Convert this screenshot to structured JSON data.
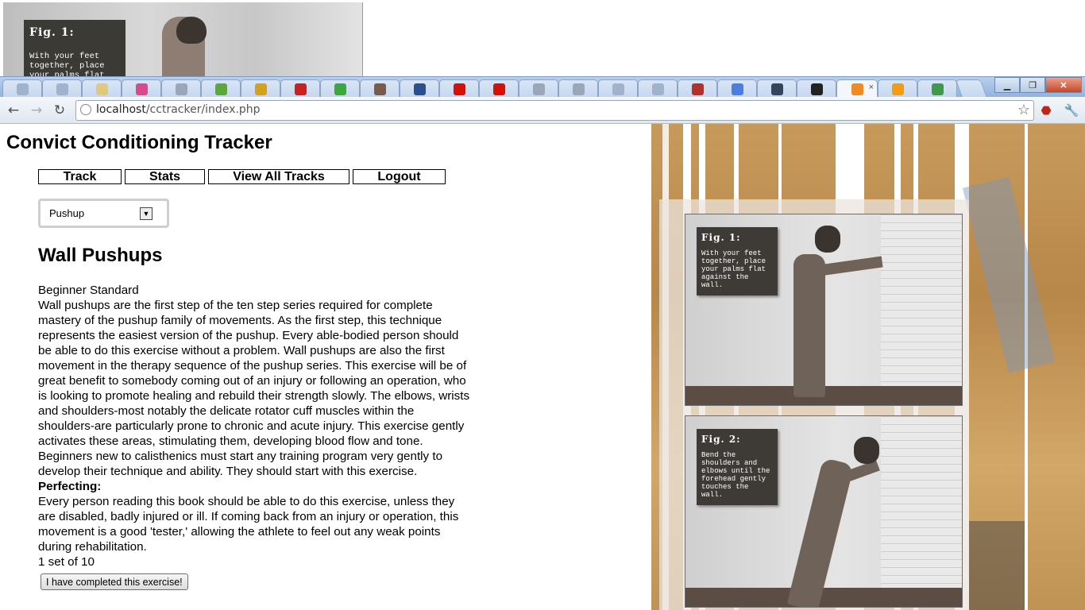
{
  "float_fig": {
    "caption_title": "Fig. 1:",
    "caption_text": "With your feet together, place your palms flat"
  },
  "browser": {
    "tabs": [
      {
        "icon": "reddit-icon",
        "color": "#9fb4cc"
      },
      {
        "icon": "reddit-icon",
        "color": "#9fb4cc"
      },
      {
        "icon": "heart-icon",
        "color": "#e0c97a"
      },
      {
        "icon": "d20-icon",
        "color": "#d94a8c"
      },
      {
        "icon": "globe-icon",
        "color": "#9aa7b8"
      },
      {
        "icon": "sprout-icon",
        "color": "#5aa83a"
      },
      {
        "icon": "fish-icon",
        "color": "#d4a21a"
      },
      {
        "icon": "youtube-icon",
        "color": "#cc2020"
      },
      {
        "icon": "meetup-icon",
        "color": "#3aa83a"
      },
      {
        "icon": "avatar-icon",
        "color": "#7a5a4a"
      },
      {
        "icon": "pandora-icon",
        "color": "#2b4f8f"
      },
      {
        "icon": "lastfm-icon",
        "color": "#d51007"
      },
      {
        "icon": "lastfm-icon",
        "color": "#d51007"
      },
      {
        "icon": "globe-icon",
        "color": "#9aa7b8"
      },
      {
        "icon": "globe-icon",
        "color": "#9aa7b8"
      },
      {
        "icon": "reddit-icon",
        "color": "#9fb4cc"
      },
      {
        "icon": "reddit-icon",
        "color": "#9fb4cc"
      },
      {
        "icon": "graduation-icon",
        "color": "#b5302a"
      },
      {
        "icon": "google-icon",
        "color": "#4a7fe0"
      },
      {
        "icon": "tumblr-icon",
        "color": "#35465c"
      },
      {
        "icon": "github-icon",
        "color": "#222222"
      },
      {
        "icon": "xampp-icon",
        "color": "#f08a24",
        "active": true
      },
      {
        "icon": "phpmyadmin-icon",
        "color": "#f39c12"
      },
      {
        "icon": "spreadsheet-icon",
        "color": "#3c9a4a"
      }
    ],
    "url_host": "localhost",
    "url_path": "/cctracker/index.php"
  },
  "app": {
    "title": "Convict Conditioning Tracker",
    "nav": {
      "track": "Track",
      "stats": "Stats",
      "view_all": "View All Tracks",
      "logout": "Logout"
    },
    "select": {
      "value": "Pushup"
    },
    "exercise": {
      "title": "Wall Pushups",
      "standard": "Beginner Standard",
      "description": "Wall pushups are the first step of the ten step series required for complete mastery of the pushup family of movements. As the first step, this technique represents the easiest version of the pushup. Every able-bodied person should be able to do this exercise without a problem. Wall pushups are also the first movement in the therapy sequence of the pushup series. This exercise will be of great benefit to somebody coming out of an injury or following an operation, who is looking to promote healing and rebuild their strength slowly. The elbows, wrists and shoulders-most notably the delicate rotator cuff muscles within the shoulders-are particularly prone to chronic and acute injury. This exercise gently activates these areas, stimulating them, developing blood flow and tone. Beginners new to calisthenics must start any training program very gently to develop their technique and ability. They should start with this exercise.",
      "perfecting_heading": "Perfecting:",
      "perfecting_text": "Every person reading this book should be able to do this exercise, unless they are disabled, badly injured or ill. If coming back from an injury or operation, this movement is a good 'tester,' allowing the athlete to feel out any weak points during rehabilitation.",
      "progress": "1 set of 10",
      "complete_button": "I have completed this exercise!"
    }
  },
  "illustration": {
    "fig1": {
      "title": "Fig. 1:",
      "text": "With your feet together, place your palms flat against the wall."
    },
    "fig2": {
      "title": "Fig. 2:",
      "text": "Bend the shoulders and elbows until the forehead gently touches the wall."
    }
  }
}
